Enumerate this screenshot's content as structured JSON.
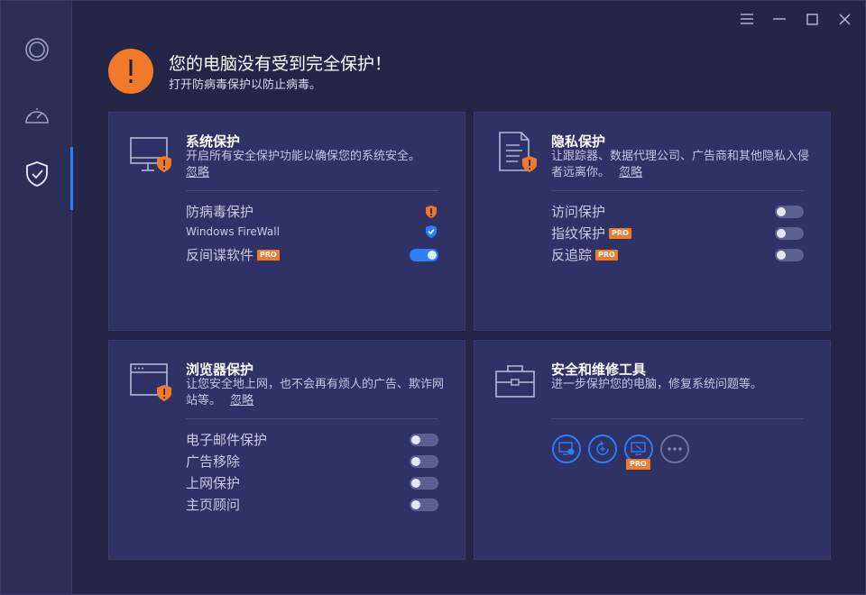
{
  "header": {
    "title": "您的电脑没有受到完全保护！",
    "subtitle": "打开防病毒保护以防止病毒。"
  },
  "colors": {
    "accent": "#2f7ef5",
    "warning": "#f07a2a",
    "panel": "#2f3264",
    "background": "#242648"
  },
  "sidebar": {
    "items": [
      {
        "icon": "target-icon"
      },
      {
        "icon": "speedometer-icon"
      },
      {
        "icon": "shield-check-icon",
        "active": true
      }
    ]
  },
  "window_controls": [
    "menu-icon",
    "minimize-icon",
    "maximize-icon",
    "close-icon"
  ],
  "panels": {
    "system": {
      "title": "系统保护",
      "desc": "开启所有安全保护功能以确保您的系统安全。",
      "ignore": "忽略",
      "rows": [
        {
          "label": "防病毒保护",
          "status": "warning"
        },
        {
          "label": "Windows FireWall",
          "status": "ok"
        },
        {
          "label": "反间谍软件",
          "pro": "PRO",
          "toggle": true
        }
      ]
    },
    "privacy": {
      "title": "隐私保护",
      "desc": "让跟踪器、数据代理公司、广告商和其他隐私入侵者远离你。",
      "ignore": "忽略",
      "rows": [
        {
          "label": "访问保护",
          "toggle": false
        },
        {
          "label": "指纹保护",
          "pro": "PRO",
          "toggle": false
        },
        {
          "label": "反追踪",
          "pro": "PRO",
          "toggle": false
        }
      ]
    },
    "browser": {
      "title": "浏览器保护",
      "desc": "让您安全地上网，也不会再有烦人的广告、欺诈网站等。",
      "ignore": "忽略",
      "rows": [
        {
          "label": "电子邮件保护",
          "toggle": false
        },
        {
          "label": "广告移除",
          "toggle": false
        },
        {
          "label": "上网保护",
          "toggle": false
        },
        {
          "label": "主页顾问",
          "toggle": false
        }
      ]
    },
    "tools": {
      "title": "安全和维修工具",
      "desc": "进一步保护您的电脑，修复系统问题等。",
      "pro": "PRO"
    }
  }
}
